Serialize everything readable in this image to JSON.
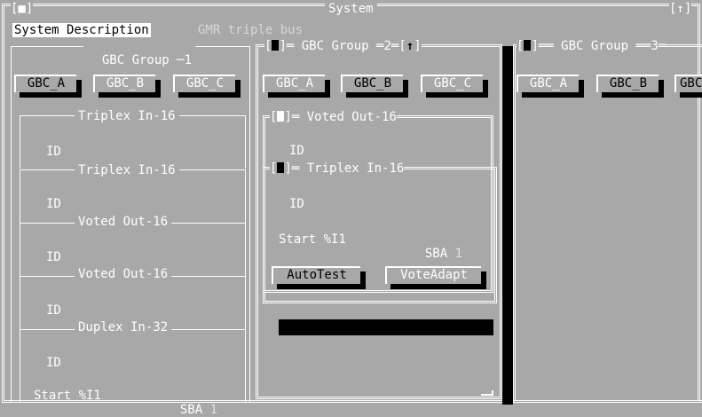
{
  "window": {
    "title": "System",
    "close_glyph": "[■]",
    "zoom_glyph": "[↑]"
  },
  "tabs": [
    "System Description",
    "GMR triple bus"
  ],
  "groups": [
    {
      "title": "GBC Group",
      "number": "1",
      "buttons": [
        "GBC_A",
        "GBC_B",
        "GBC_C"
      ],
      "panels": [
        {
          "title": "Triplex In-16",
          "id": "ID"
        },
        {
          "title": "Triplex In-16",
          "id": "ID"
        },
        {
          "title": "Voted Out-16",
          "id": "ID"
        },
        {
          "title": "Voted Out-16",
          "id": "ID"
        },
        {
          "title": "Duplex In-32",
          "id": "ID",
          "start": "Start %I1",
          "sba": "SBA",
          "sba_value": "1"
        }
      ]
    },
    {
      "title": "GBC Group",
      "number": "2",
      "buttons": [
        "GBC_A",
        "GBC_B",
        "GBC_C"
      ],
      "voted": {
        "title": "Voted Out-16",
        "id": "ID"
      },
      "triplex": {
        "title": "Triplex In-16",
        "id": "ID",
        "start": "Start %I1",
        "sba": "SBA",
        "sba_value": "1",
        "actions": [
          "AutoTest",
          "VoteAdapt"
        ]
      }
    },
    {
      "title": "GBC Group",
      "number": "3",
      "buttons": [
        "GBC_A",
        "GBC_B",
        "GBC"
      ]
    }
  ],
  "colors": {
    "background": "#a8a8a8",
    "frame": "#ffffff",
    "shadow": "#000000",
    "highlight": "#ffffff"
  }
}
